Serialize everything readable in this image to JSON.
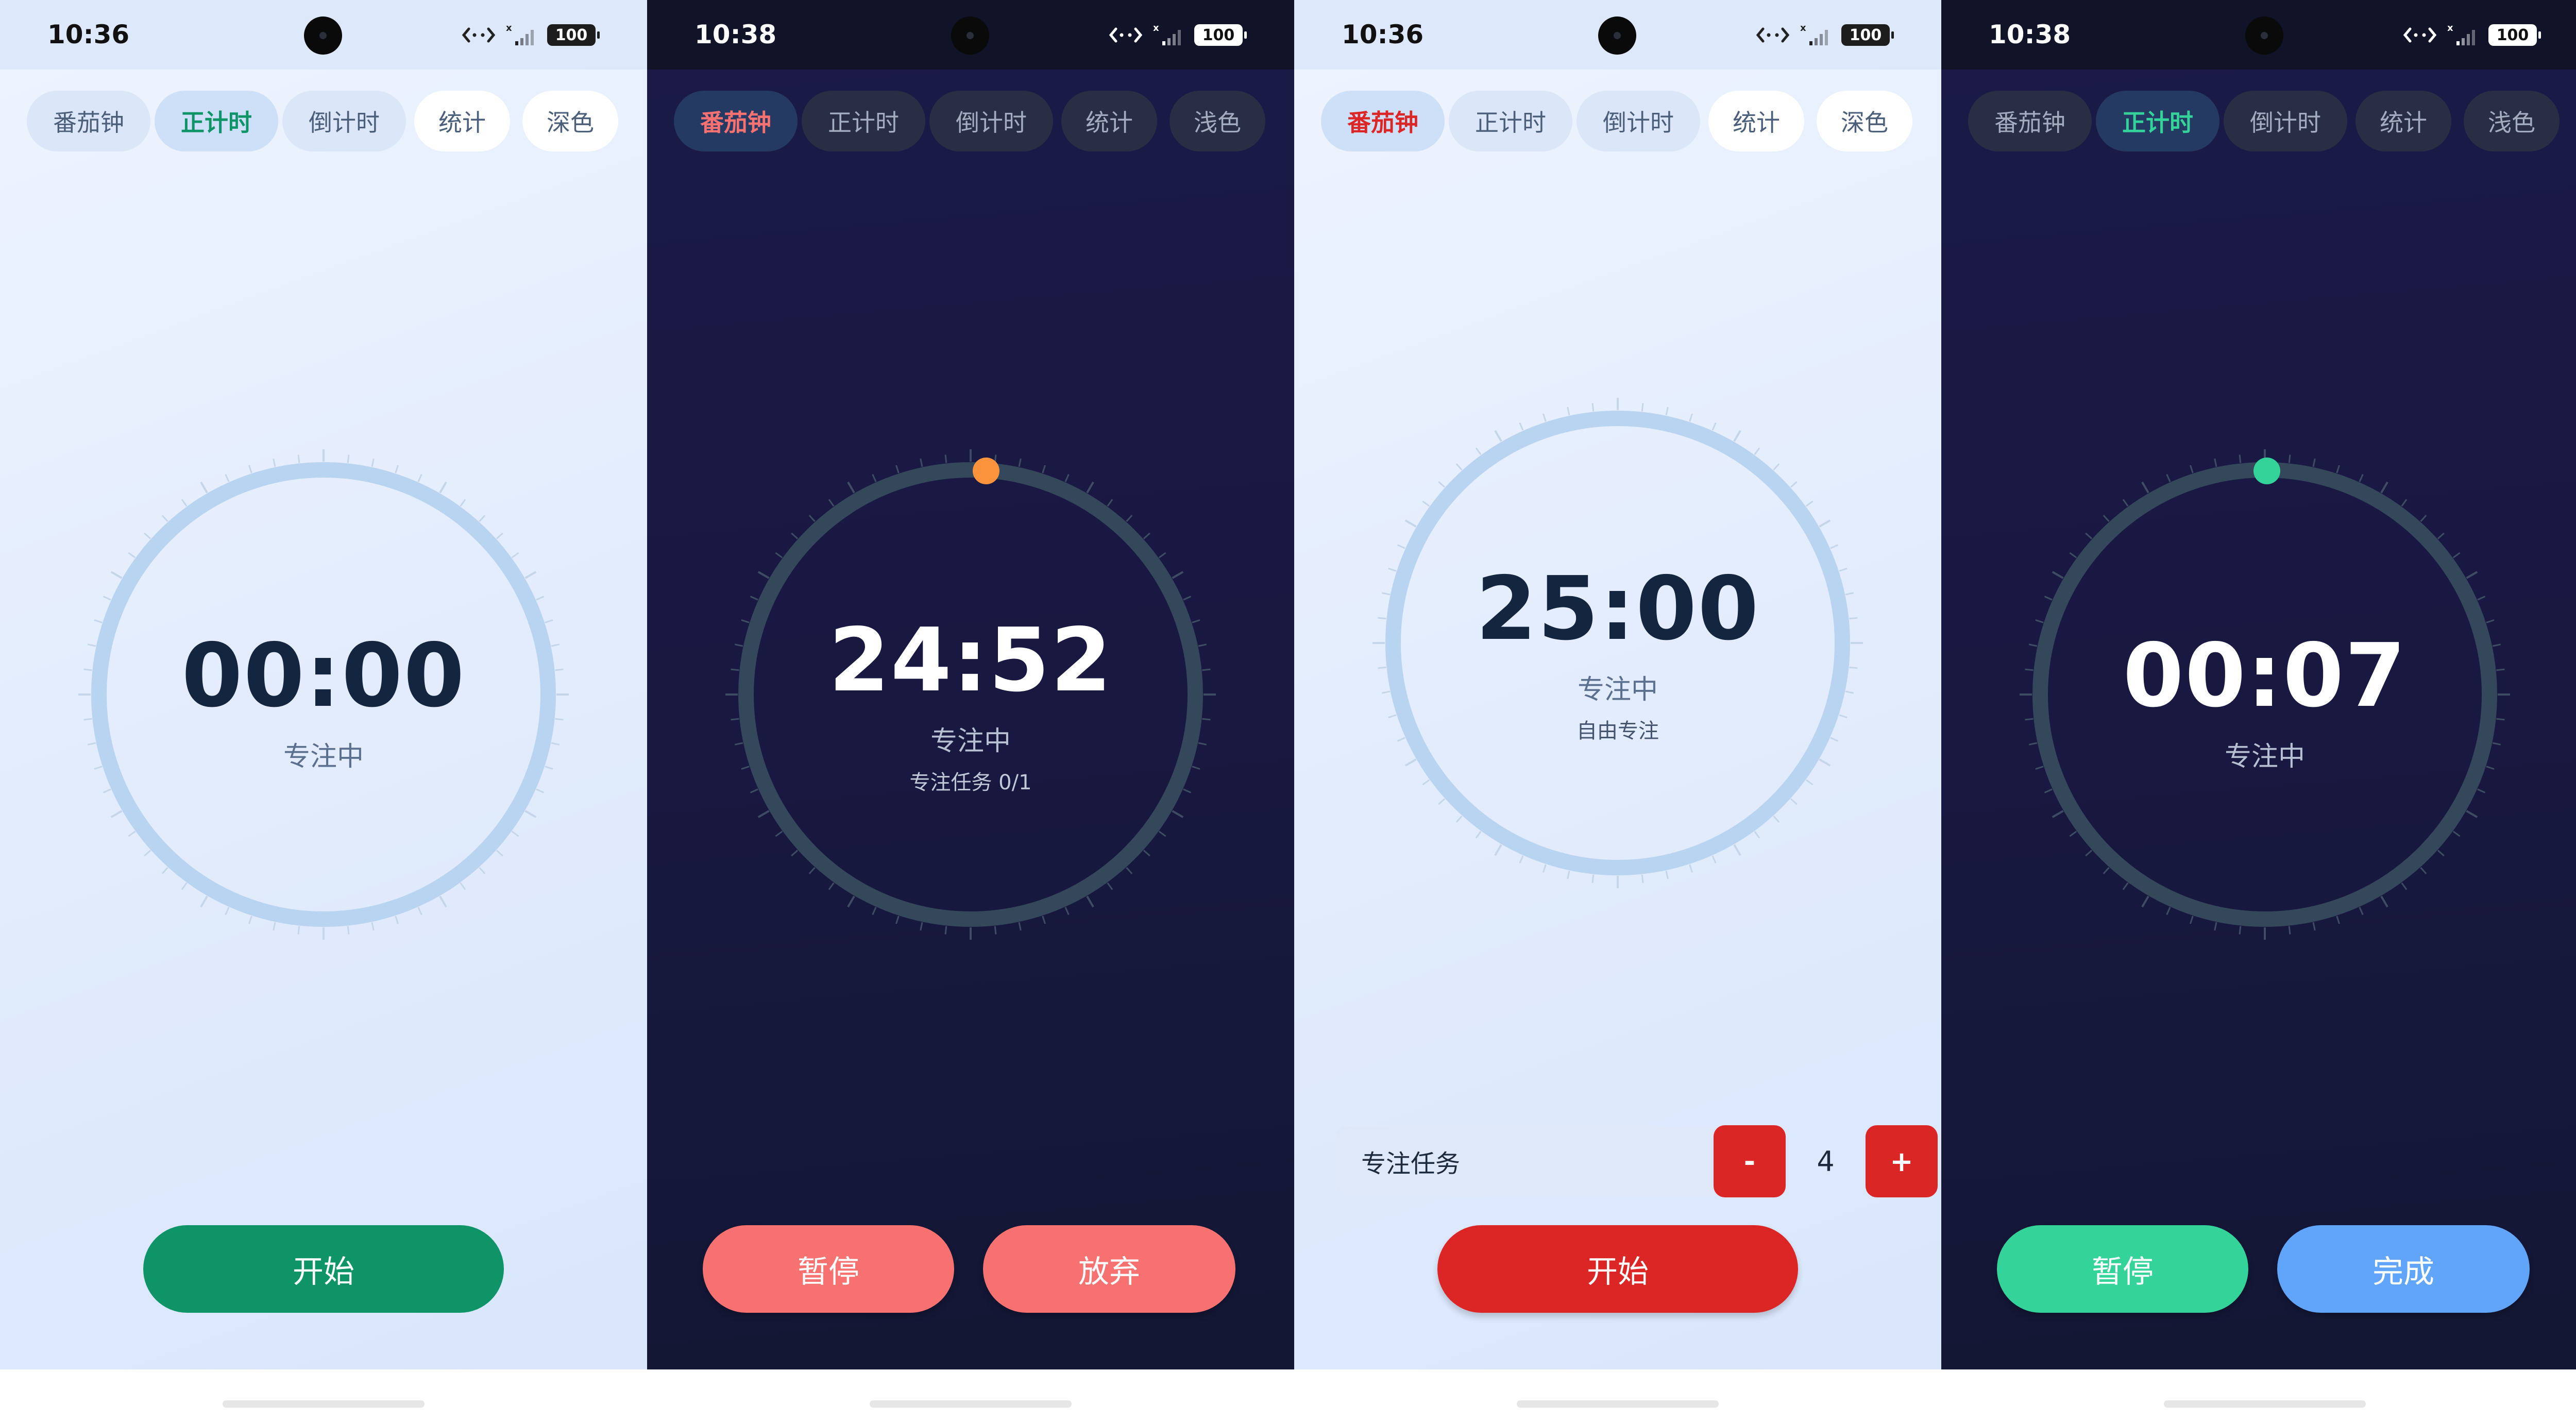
{
  "screens": [
    {
      "status": {
        "time": "10:36",
        "battery": "100"
      },
      "tabs": [
        "番茄钟",
        "正计时",
        "倒计时",
        "统计",
        "深色"
      ],
      "active_tab": 1,
      "timer": {
        "time": "00:00",
        "label": "专注中",
        "progress": 0
      },
      "buttons": [
        "开始"
      ]
    },
    {
      "status": {
        "time": "10:38",
        "battery": "100"
      },
      "tabs": [
        "番茄钟",
        "正计时",
        "倒计时",
        "统计",
        "浅色"
      ],
      "active_tab": 0,
      "timer": {
        "time": "24:52",
        "label": "专注中",
        "detail": "专注任务 0/1",
        "progress": 0.009
      },
      "buttons": [
        "暂停",
        "放弃"
      ]
    },
    {
      "status": {
        "time": "10:36",
        "battery": "100"
      },
      "tabs": [
        "番茄钟",
        "正计时",
        "倒计时",
        "统计",
        "深色"
      ],
      "active_tab": 0,
      "timer": {
        "time": "25:00",
        "label": "专注中",
        "detail": "自由专注",
        "progress": 0
      },
      "task": {
        "label": "专注任务",
        "minus": "-",
        "count": "4",
        "plus": "+"
      },
      "buttons": [
        "开始"
      ]
    },
    {
      "status": {
        "time": "10:38",
        "battery": "100"
      },
      "tabs": [
        "番茄钟",
        "正计时",
        "倒计时",
        "统计",
        "浅色"
      ],
      "active_tab": 1,
      "timer": {
        "time": "00:07",
        "label": "专注中",
        "progress": 0.002
      },
      "buttons": [
        "暂停",
        "完成"
      ]
    }
  ],
  "colors": {
    "green": "#0f9468",
    "mint": "#34d399",
    "coral": "#f87171",
    "red": "#dc2626",
    "blue": "#60a5fa",
    "orange": "#fb923c",
    "light_ring": "#b9d4f0",
    "dark_ring": "#34475b",
    "tick_light": "#c6d6ea",
    "tick_dark": "#3e4d63"
  },
  "icons": [
    "camera-icon",
    "data-transfer-icon",
    "signal-icon",
    "battery-icon"
  ]
}
